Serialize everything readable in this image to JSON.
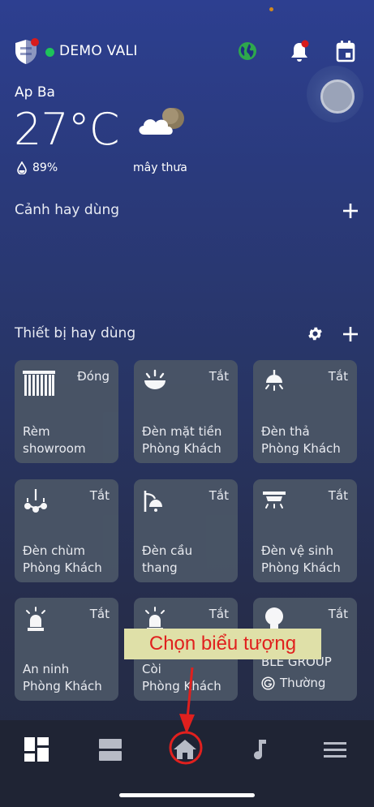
{
  "header": {
    "home_name": "DEMO VALI",
    "status_color": "#1ec35a",
    "icons": [
      "shield-icon",
      "globe-icon",
      "bell-icon",
      "calendar-icon",
      "assistant-button"
    ]
  },
  "weather": {
    "location": "Ap Ba",
    "temperature": "27°C",
    "humidity": "89%",
    "condition": "mây thưa",
    "icon": "partly-cloudy-night-icon"
  },
  "scenes": {
    "title": "Cảnh hay dùng"
  },
  "devices": {
    "title": "Thiết bị hay dùng",
    "tiles": [
      {
        "icon": "curtain-icon",
        "state": "Đóng",
        "line1": "Rèm",
        "line2": "showroom"
      },
      {
        "icon": "ceiling-light-icon",
        "state": "Tắt",
        "line1": "Đèn mặt tiền",
        "line2": "Phòng Khách"
      },
      {
        "icon": "pendant-light-icon",
        "state": "Tắt",
        "line1": "Đèn thả",
        "line2": "Phòng Khách"
      },
      {
        "icon": "chandelier-icon",
        "state": "Tắt",
        "line1": "Đèn chùm",
        "line2": "Phòng Khách"
      },
      {
        "icon": "wall-lamp-icon",
        "state": "Tắt",
        "line1": "Đèn cầu",
        "line2": "thang"
      },
      {
        "icon": "tube-light-icon",
        "state": "Tắt",
        "line1": "Đèn vệ sinh",
        "line2": "Phòng Khách"
      },
      {
        "icon": "siren-icon",
        "state": "Tắt",
        "line1": "An ninh",
        "line2": "Phòng Khách"
      },
      {
        "icon": "siren-icon",
        "state": "Tắt",
        "line1": "Còi",
        "line2": "Phòng Khách"
      },
      {
        "icon": "bulb-icon",
        "state": "Tắt",
        "line1": "BLE GROUP",
        "line2": "Thường"
      }
    ]
  },
  "bottom_nav": {
    "items": [
      "dashboard-icon",
      "rooms-icon",
      "home-icon",
      "music-icon",
      "menu-icon"
    ]
  },
  "annotation": {
    "text": "Chọn biểu tượng",
    "color": "#e0201e"
  }
}
